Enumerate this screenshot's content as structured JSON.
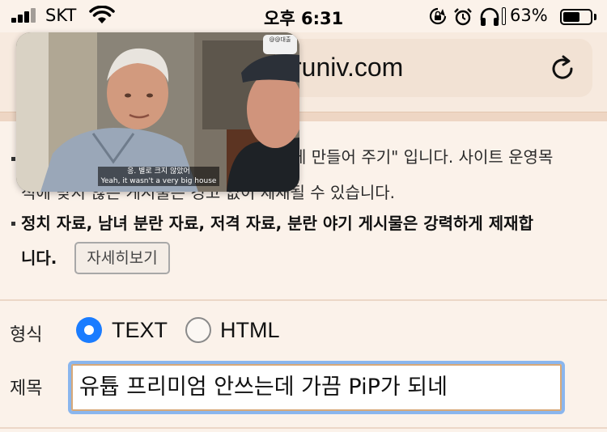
{
  "status_bar": {
    "carrier": "SKT",
    "time": "오후 6:31",
    "battery_percent": "63%",
    "battery_level": 0.63,
    "icons": [
      "signal-icon",
      "wifi-icon",
      "rotation-lock-icon",
      "alarm-icon",
      "headphones-icon",
      "battery-icon"
    ]
  },
  "browser": {
    "url_visible": "runiv.com",
    "reload_icon": "reload-icon"
  },
  "pip_video": {
    "channel_badge": "@@대출",
    "subtitle_korean": "응. 별로 크지 않았어",
    "subtitle_english": "Yeah, it wasn't a very big house"
  },
  "notice": {
    "line1_visible": "게 만들어 주기\" 입니다. 사이트 운영목",
    "line2_visible": "적에 맞지 않은 게시물은 경고 없이 제재될 수 있습니다.",
    "line3": "정치 자료, 남녀 분란 자료, 저격 자료, 분란 야기 게시물은 강력하게 제재합",
    "line4": "니다.",
    "detail_button_label": "자세히보기"
  },
  "form": {
    "format_label": "형식",
    "format_options": [
      {
        "label": "TEXT",
        "selected": true
      },
      {
        "label": "HTML",
        "selected": false
      }
    ],
    "title_label": "제목",
    "title_value": "유튭 프리미엄 안쓰는데 가끔 PiP가 되네"
  },
  "colors": {
    "page_bg": "#fbf2ea",
    "accent_blue": "#1a7cff",
    "input_focus": "#8ab6ee"
  }
}
